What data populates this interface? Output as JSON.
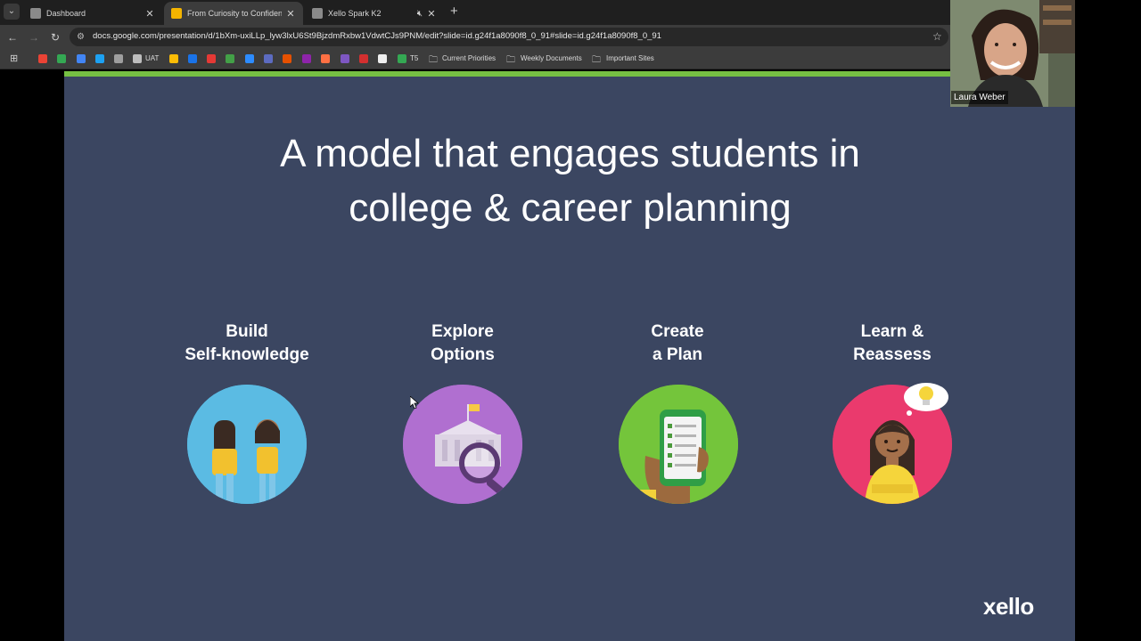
{
  "browser": {
    "tabs": [
      {
        "label": "Dashboard",
        "active": false
      },
      {
        "label": "From Curiosity to Confidence: E",
        "active": true
      },
      {
        "label": "Xello Spark K2",
        "active": false
      }
    ],
    "url": "docs.google.com/presentation/d/1bXm-uxiLLp_lyw3lxU6St9BjzdmRxbw1VdwtCJs9PNM/edit?slide=id.g24f1a8090f8_0_91#slide=id.g24f1a8090f8_0_91",
    "bookmarks": {
      "uat": "UAT",
      "t5": "T5",
      "folders": [
        "Current Priorities",
        "Weekly Documents",
        "Important Sites"
      ]
    }
  },
  "slide": {
    "title_line1": "A model that engages students in",
    "title_line2": "college & career planning",
    "columns": [
      {
        "label": "Build\nSelf-knowledge",
        "icon": "students-icon",
        "color": "#4aaedb"
      },
      {
        "label": "Explore\nOptions",
        "icon": "college-search-icon",
        "color": "#a667c9"
      },
      {
        "label": "Create\na Plan",
        "icon": "phone-checklist-icon",
        "color": "#6cbf33"
      },
      {
        "label": "Learn &\nReassess",
        "icon": "student-idea-icon",
        "color": "#e8336a"
      }
    ],
    "logo": "xello",
    "accent_color": "#76c043",
    "background_color": "#3b4661"
  },
  "video_call": {
    "participant_name": "Laura Weber"
  }
}
